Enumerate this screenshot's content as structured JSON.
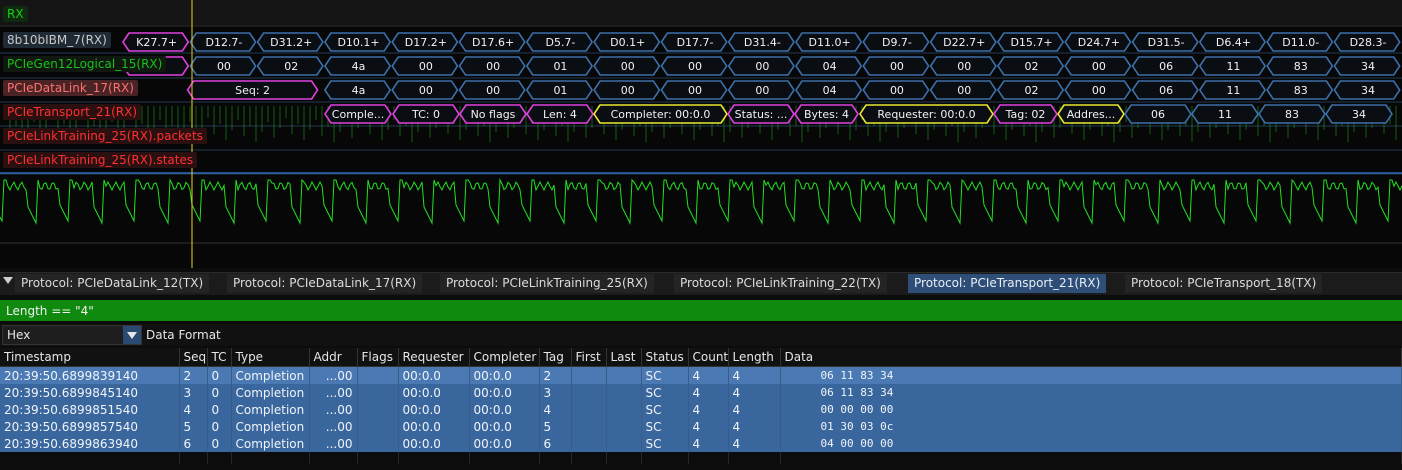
{
  "waveform": {
    "trigger_label": "RX",
    "channels": [
      {
        "label": "8b10bIBM_7(RX)",
        "color": "#c8c8c8",
        "bg": "#1f2a35"
      },
      {
        "label": "PCIeGen12Logical_15(RX)",
        "color": "#18c018",
        "bg": "#101810"
      },
      {
        "label": "PCIeDataLink_17(RX)",
        "color": "#ff7070",
        "bg": "#4a2424"
      },
      {
        "label": "PCIeTransport_21(RX)",
        "color": "#ff3030",
        "bg": "#2a1010"
      },
      {
        "label": "PCIeLinkTraining_25(RX).packets",
        "color": "#ff3030",
        "bg": "#2a1010"
      },
      {
        "label": "PCIeLinkTraining_25(RX).states",
        "color": "#ff3030",
        "bg": "#2a1010"
      }
    ],
    "symbols_8b10b": [
      "K27.7+",
      "D12.7-",
      "D31.2+",
      "D10.1+",
      "D17.2+",
      "D17.6+",
      "D5.7-",
      "D0.1+",
      "D17.7-",
      "D31.4-",
      "D11.0+",
      "D9.7-",
      "D22.7+",
      "D15.7+",
      "D24.7+",
      "D31.5-",
      "D6.4+",
      "D11.0-",
      "D28.3-"
    ],
    "logical_bytes": [
      "",
      "00",
      "02",
      "4a",
      "00",
      "00",
      "01",
      "00",
      "00",
      "00",
      "04",
      "00",
      "00",
      "02",
      "00",
      "06",
      "11",
      "83",
      "34"
    ],
    "datalink_seq": "Seq: 2",
    "datalink_bytes": [
      "4a",
      "00",
      "00",
      "01",
      "00",
      "00",
      "00",
      "04",
      "00",
      "00",
      "02",
      "00",
      "06",
      "11",
      "83",
      "34"
    ],
    "transport_fields": [
      "Comple...",
      "TC: 0",
      "No flags",
      "Len: 4",
      "Completer: 00:0.0",
      "Status: ...",
      "Bytes: 4",
      "Requester: 00:0.0",
      "Tag: 02",
      "Addres...",
      "06",
      "11",
      "83",
      "34"
    ],
    "colors": {
      "bus": "#3d6fa8",
      "magenta": "#e040e0",
      "yellow": "#e8e830",
      "analog": "#22e022",
      "cursor": "#e8d020"
    }
  },
  "tabs": [
    {
      "label": "Protocol: PCIeDataLink_12(TX)",
      "active": false
    },
    {
      "label": "Protocol: PCIeDataLink_17(RX)",
      "active": false
    },
    {
      "label": "Protocol: PCIeLinkTraining_25(RX)",
      "active": false
    },
    {
      "label": "Protocol: PCIeLinkTraining_22(TX)",
      "active": false
    },
    {
      "label": "Protocol: PCIeTransport_21(RX)",
      "active": true
    },
    {
      "label": "Protocol: PCIeTransport_18(TX)",
      "active": false
    }
  ],
  "filter": {
    "value": "Length == \"4\""
  },
  "format": {
    "selected": "Hex",
    "label": "Data Format"
  },
  "table": {
    "columns": [
      "Timestamp",
      "Seq",
      "TC",
      "Type",
      "Addr",
      "Flags",
      "Requester",
      "Completer",
      "Tag",
      "First",
      "Last",
      "Status",
      "Count",
      "Length",
      "Data"
    ],
    "rows": [
      [
        "20:39:50.6899839140",
        "2",
        "0",
        "Completion",
        "...00",
        "",
        "00:0.0",
        "00:0.0",
        "2",
        "",
        "",
        "SC",
        "4",
        "4",
        "06 11 83 34"
      ],
      [
        "20:39:50.6899845140",
        "3",
        "0",
        "Completion",
        "...00",
        "",
        "00:0.0",
        "00:0.0",
        "3",
        "",
        "",
        "SC",
        "4",
        "4",
        "06 11 83 34"
      ],
      [
        "20:39:50.6899851540",
        "4",
        "0",
        "Completion",
        "...00",
        "",
        "00:0.0",
        "00:0.0",
        "4",
        "",
        "",
        "SC",
        "4",
        "4",
        "00 00 00 00"
      ],
      [
        "20:39:50.6899857540",
        "5",
        "0",
        "Completion",
        "...00",
        "",
        "00:0.0",
        "00:0.0",
        "5",
        "",
        "",
        "SC",
        "4",
        "4",
        "01 30 03 0c"
      ],
      [
        "20:39:50.6899863940",
        "6",
        "0",
        "Completion",
        "...00",
        "",
        "00:0.0",
        "00:0.0",
        "6",
        "",
        "",
        "SC",
        "4",
        "4",
        "04 00 00 00"
      ]
    ]
  }
}
